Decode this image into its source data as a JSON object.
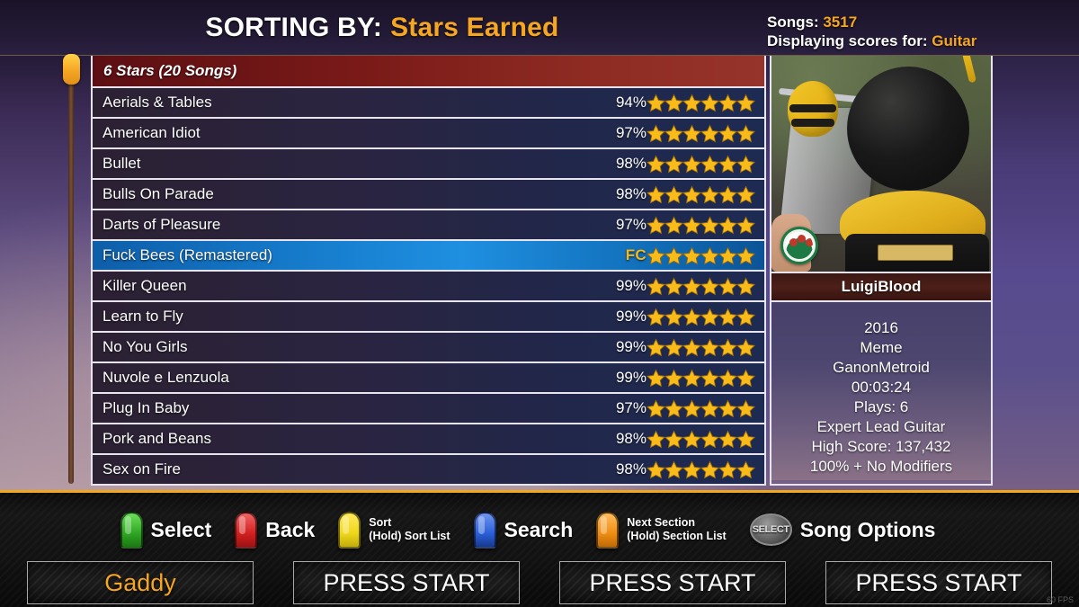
{
  "header": {
    "sorting_prefix": "SORTING BY:",
    "sorting_value": "Stars Earned",
    "songs_label": "Songs:",
    "songs_count": "3517",
    "displaying_label": "Displaying scores for:",
    "displaying_value": "Guitar",
    "accent_color": "#f5a623"
  },
  "list": {
    "section_header": "6 Stars (20 Songs)",
    "rows": [
      {
        "name": "Aerials & Tables",
        "score": "94%",
        "stars": 6,
        "fc": false,
        "selected": false
      },
      {
        "name": "American Idiot",
        "score": "97%",
        "stars": 6,
        "fc": false,
        "selected": false
      },
      {
        "name": "Bullet",
        "score": "98%",
        "stars": 6,
        "fc": false,
        "selected": false
      },
      {
        "name": "Bulls On Parade",
        "score": "98%",
        "stars": 6,
        "fc": false,
        "selected": false
      },
      {
        "name": "Darts of Pleasure",
        "score": "97%",
        "stars": 6,
        "fc": false,
        "selected": false
      },
      {
        "name": "Fuck Bees (Remastered)",
        "score": "FC",
        "stars": 6,
        "fc": true,
        "selected": true
      },
      {
        "name": "Killer Queen",
        "score": "99%",
        "stars": 6,
        "fc": false,
        "selected": false
      },
      {
        "name": "Learn to Fly",
        "score": "99%",
        "stars": 6,
        "fc": false,
        "selected": false
      },
      {
        "name": "No You Girls",
        "score": "99%",
        "stars": 6,
        "fc": false,
        "selected": false
      },
      {
        "name": "Nuvole e Lenzuola",
        "score": "99%",
        "stars": 6,
        "fc": false,
        "selected": false
      },
      {
        "name": "Plug In Baby",
        "score": "97%",
        "stars": 6,
        "fc": false,
        "selected": false
      },
      {
        "name": "Pork and Beans",
        "score": "98%",
        "stars": 6,
        "fc": false,
        "selected": false
      },
      {
        "name": "Sex on Fire",
        "score": "98%",
        "stars": 6,
        "fc": false,
        "selected": false
      }
    ]
  },
  "detail": {
    "artist": "LuigiBlood",
    "meta_lines": [
      "2016",
      "Meme",
      "GanonMetroid",
      "00:03:24",
      "Plays: 6",
      "Expert Lead Guitar",
      "High Score: 137,432",
      "100% + No Modifiers"
    ]
  },
  "hints": [
    {
      "color": "green",
      "label": "Select",
      "sub": null
    },
    {
      "color": "red",
      "label": "Back",
      "sub": null
    },
    {
      "color": "yellow",
      "label": "Sort",
      "sub": "(Hold) Sort List"
    },
    {
      "color": "blue",
      "label": "Search",
      "sub": null
    },
    {
      "color": "orange",
      "label": "Next Section",
      "sub": "(Hold) Section List"
    }
  ],
  "select_hint": {
    "button_text": "SELECT",
    "label": "Song Options"
  },
  "players": [
    {
      "text": "Gaddy",
      "named": true
    },
    {
      "text": "PRESS START",
      "named": false
    },
    {
      "text": "PRESS START",
      "named": false
    },
    {
      "text": "PRESS START",
      "named": false
    }
  ],
  "fps": "60 FPS"
}
